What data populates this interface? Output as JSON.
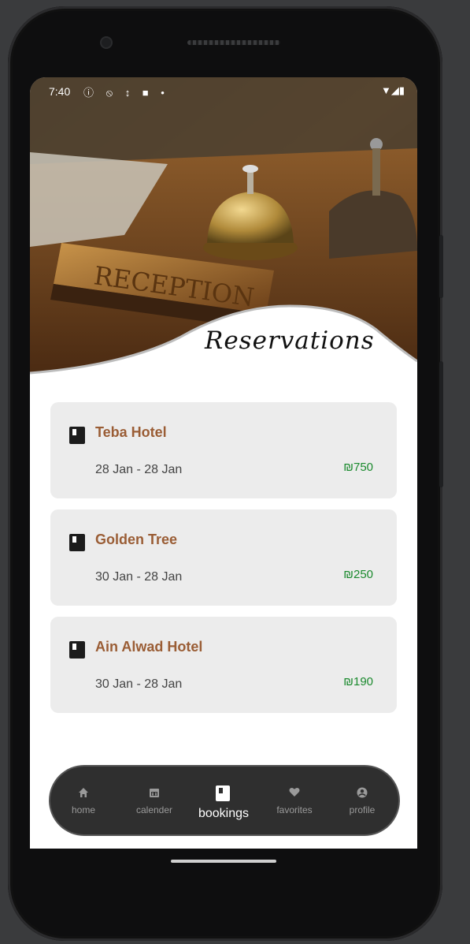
{
  "status_bar": {
    "time": "7:40",
    "left_icons": "ⓘ ⦸ ↕ ■ •",
    "right_icons": "▼◢▮"
  },
  "hero": {
    "image_description_icon": "reception-bell-photo",
    "title": "Reservations"
  },
  "reservations": [
    {
      "name": "Teba Hotel",
      "dates": "28 Jan - 28 Jan",
      "price": "₪750"
    },
    {
      "name": "Golden Tree",
      "dates": "30 Jan - 28 Jan",
      "price": "₪250"
    },
    {
      "name": "Ain Alwad Hotel",
      "dates": "30 Jan - 28 Jan",
      "price": "₪190"
    }
  ],
  "nav": {
    "home": "home",
    "calender": "calender",
    "bookings": "bookings",
    "favorites": "favorites",
    "profile": "profile"
  },
  "colors": {
    "hotel_name": "#9a5d35",
    "price": "#1b8a2e",
    "card_bg": "#ececec",
    "nav_bg": "#2f2f2f"
  }
}
